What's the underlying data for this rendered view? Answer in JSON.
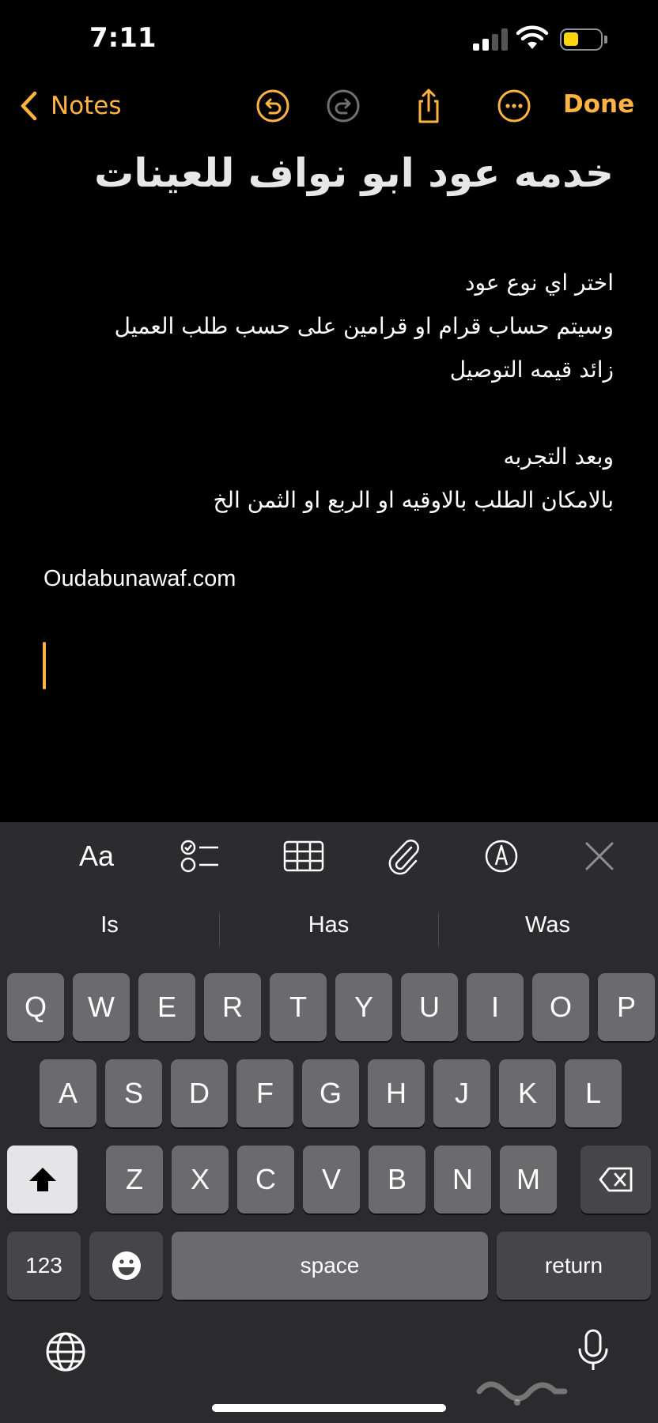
{
  "status": {
    "time": "7:11"
  },
  "nav": {
    "back_label": "Notes",
    "done_label": "Done"
  },
  "note": {
    "title": "خدمه عود ابو نواف للعينات",
    "lines": [
      "اختر اي نوع عود",
      "وسيتم حساب قرام او قرامين على حسب طلب العميل",
      "زائد قيمه التوصيل",
      "",
      "وبعد التجربه",
      "بالامكان الطلب بالاوقيه او الربع او الثمن الخ"
    ],
    "url": "Oudabunawaf.com"
  },
  "toolbar": {
    "format_label": "Aa"
  },
  "keyboard": {
    "suggestions": [
      "Is",
      "Has",
      "Was"
    ],
    "row1": [
      "Q",
      "W",
      "E",
      "R",
      "T",
      "Y",
      "U",
      "I",
      "O",
      "P"
    ],
    "row2": [
      "A",
      "S",
      "D",
      "F",
      "G",
      "H",
      "J",
      "K",
      "L"
    ],
    "row3": [
      "Z",
      "X",
      "C",
      "V",
      "B",
      "N",
      "M"
    ],
    "numbers_label": "123",
    "space_label": "space",
    "return_label": "return"
  },
  "watermark": "حراج",
  "colors": {
    "accent": "#ffb340",
    "background": "#000000",
    "keyboard": "#2b2b2d",
    "key": "#6b6b6e"
  }
}
